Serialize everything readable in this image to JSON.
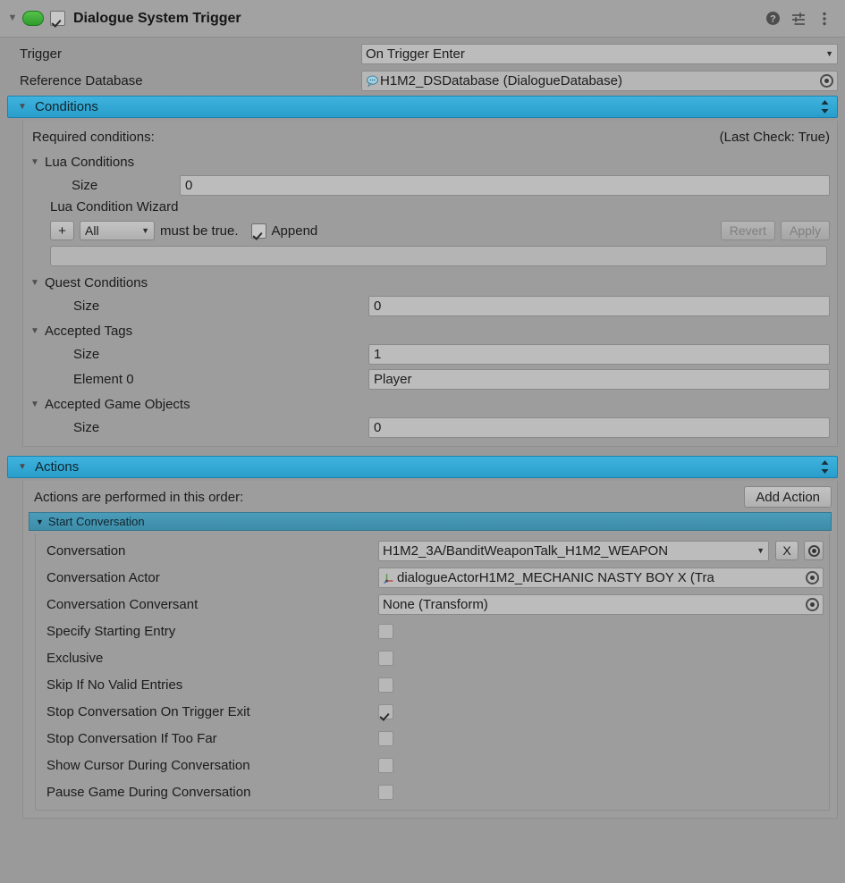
{
  "component": {
    "title": "Dialogue System Trigger",
    "enabled_checkbox": true,
    "script_icon": "script-component-icon",
    "header_icons": [
      "help-icon",
      "preset-icon",
      "more-menu-icon"
    ],
    "accent_blue": "#2a9ecb",
    "accent_teal": "#3d8da9",
    "background": "#9a9a9a"
  },
  "properties": [
    {
      "label": "Trigger",
      "value": "On Trigger Enter",
      "kind": "dropdown"
    },
    {
      "label": "Reference Database",
      "value": "H1M2_DSDatabase (DialogueDatabase)",
      "kind": "object",
      "icon": "dialogue-database-icon"
    }
  ],
  "conditions": {
    "header": "Conditions",
    "required_label": "Required conditions:",
    "last_check": "(Last Check: True)",
    "lua_conditions": {
      "label": "Lua Conditions",
      "size_label": "Size",
      "size_value": "0"
    },
    "lua_wizard": {
      "label": "Lua Condition Wizard",
      "add_button": "+",
      "mode": "All",
      "must_be_true": "must be true.",
      "append_label": "Append",
      "append_checked": true,
      "revert_button": "Revert",
      "apply_button": "Apply",
      "code_field_value": ""
    },
    "quest_conditions": {
      "label": "Quest Conditions",
      "size_label": "Size",
      "size_value": "0"
    },
    "accepted_tags": {
      "label": "Accepted Tags",
      "size_label": "Size",
      "size_value": "1",
      "element_label": "Element 0",
      "element_value": "Player"
    },
    "accepted_game_objects": {
      "label": "Accepted Game Objects",
      "size_label": "Size",
      "size_value": "0"
    }
  },
  "actions": {
    "header": "Actions",
    "order_note": "Actions are performed in this order:",
    "add_action_button": "Add Action",
    "start_conversation": {
      "header": "Start Conversation",
      "fields": [
        {
          "label": "Conversation",
          "value": "H1M2_3A/BanditWeaponTalk_H1M2_WEAPON",
          "kind": "dropdown-with-clear",
          "clear_button": "X"
        },
        {
          "label": "Conversation Actor",
          "value": "dialogueActorH1M2_MECHANIC NASTY BOY X (Tra",
          "kind": "object",
          "icon": "transform-icon"
        },
        {
          "label": "Conversation Conversant",
          "value": "None (Transform)",
          "kind": "object"
        }
      ],
      "toggles": [
        {
          "label": "Specify Starting Entry",
          "checked": false
        },
        {
          "label": "Exclusive",
          "checked": false
        },
        {
          "label": "Skip If No Valid Entries",
          "checked": false
        },
        {
          "label": "Stop Conversation On Trigger Exit",
          "checked": true
        },
        {
          "label": "Stop Conversation If Too Far",
          "checked": false
        },
        {
          "label": "Show Cursor During Conversation",
          "checked": false
        },
        {
          "label": "Pause Game During Conversation",
          "checked": false
        }
      ]
    }
  }
}
